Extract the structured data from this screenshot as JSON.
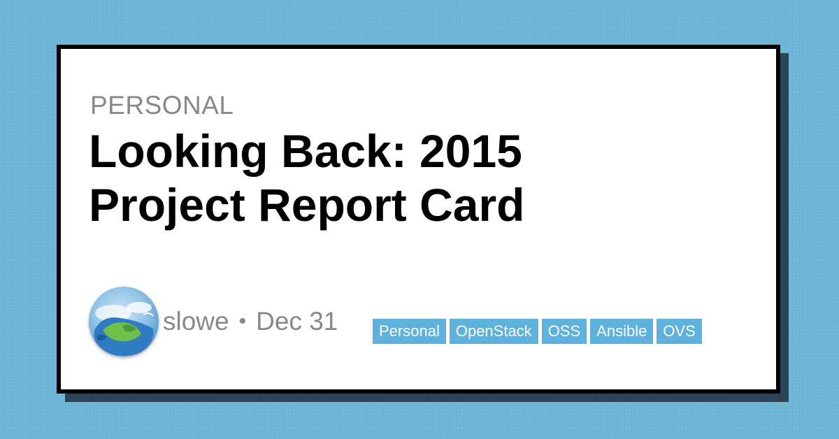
{
  "card": {
    "category": "PERSONAL",
    "title_line1": "Looking Back: 2015",
    "title_line2": "Project Report Card"
  },
  "author": {
    "name": "slowe",
    "separator": "•",
    "date": "Dec 31",
    "avatar_icon": "globe-avatar-icon"
  },
  "tags": [
    "Personal",
    "OpenStack",
    "OSS",
    "Ansible",
    "OVS"
  ],
  "colors": {
    "background": "#6bb6d6",
    "card": "#ffffff",
    "border": "#000000",
    "muted_text": "#888888",
    "tag_background": "#5db1dc",
    "tag_text": "#ffffff"
  }
}
